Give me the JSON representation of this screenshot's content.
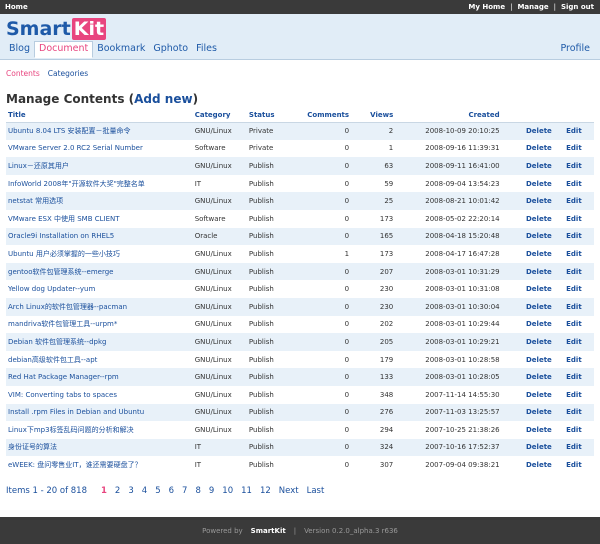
{
  "topbar": {
    "home": "Home",
    "my_home": "My Home",
    "manage": "Manage",
    "sign_out": "Sign out"
  },
  "brand": {
    "part1": "Smart",
    "part2": "Kit"
  },
  "nav": {
    "items": [
      "Blog",
      "Document",
      "Bookmark",
      "Gphoto",
      "Files"
    ],
    "active_index": 1,
    "profile": "Profile"
  },
  "subnav": {
    "contents": "Contents",
    "categories": "Categories"
  },
  "page": {
    "title": "Manage Contents (",
    "add_new": "Add new",
    "title_end": ")"
  },
  "table": {
    "headers": [
      "Title",
      "Category",
      "Status",
      "Comments",
      "Views",
      "Created",
      "",
      ""
    ],
    "delete_label": "Delete",
    "edit_label": "Edit",
    "rows": [
      {
        "title": "Ubuntu 8.04 LTS 安装配置－批量命令",
        "category": "GNU/Linux",
        "status": "Private",
        "comments": "0",
        "views": "2",
        "created": "2008-10-09 20:10:25"
      },
      {
        "title": "VMware Server 2.0 RC2 Serial Number",
        "category": "Software",
        "status": "Private",
        "comments": "0",
        "views": "1",
        "created": "2008-09-16 11:39:31"
      },
      {
        "title": "Linux－还原其用户",
        "category": "GNU/Linux",
        "status": "Publish",
        "comments": "0",
        "views": "63",
        "created": "2008-09-11 16:41:00"
      },
      {
        "title": "InfoWorld 2008年\"开源软件大奖\"完整名单",
        "category": "IT",
        "status": "Publish",
        "comments": "0",
        "views": "59",
        "created": "2008-09-04 13:54:23"
      },
      {
        "title": "netstat 常用选项",
        "category": "GNU/Linux",
        "status": "Publish",
        "comments": "0",
        "views": "25",
        "created": "2008-08-21 10:01:42"
      },
      {
        "title": "VMware ESX 中使用 SMB CLIENT",
        "category": "Software",
        "status": "Publish",
        "comments": "0",
        "views": "173",
        "created": "2008-05-02 22:20:14"
      },
      {
        "title": "Oracle9i Installation on RHEL5",
        "category": "Oracle",
        "status": "Publish",
        "comments": "0",
        "views": "165",
        "created": "2008-04-18 15:20:48"
      },
      {
        "title": "Ubuntu 用户必须掌握的一些小技巧",
        "category": "GNU/Linux",
        "status": "Publish",
        "comments": "1",
        "views": "173",
        "created": "2008-04-17 16:47:28"
      },
      {
        "title": "gentoo软件包管理系统--emerge",
        "category": "GNU/Linux",
        "status": "Publish",
        "comments": "0",
        "views": "207",
        "created": "2008-03-01 10:31:29"
      },
      {
        "title": "Yellow dog Updater--yum",
        "category": "GNU/Linux",
        "status": "Publish",
        "comments": "0",
        "views": "230",
        "created": "2008-03-01 10:31:08"
      },
      {
        "title": "Arch Linux的软件包管理器--pacman",
        "category": "GNU/Linux",
        "status": "Publish",
        "comments": "0",
        "views": "230",
        "created": "2008-03-01 10:30:04"
      },
      {
        "title": "mandriva软件包管理工具--urpm*",
        "category": "GNU/Linux",
        "status": "Publish",
        "comments": "0",
        "views": "202",
        "created": "2008-03-01 10:29:44"
      },
      {
        "title": "Debian 软件包管理系统--dpkg",
        "category": "GNU/Linux",
        "status": "Publish",
        "comments": "0",
        "views": "205",
        "created": "2008-03-01 10:29:21"
      },
      {
        "title": "debian高级软件包工具--apt",
        "category": "GNU/Linux",
        "status": "Publish",
        "comments": "0",
        "views": "179",
        "created": "2008-03-01 10:28:58"
      },
      {
        "title": "Red Hat Package Manager--rpm",
        "category": "GNU/Linux",
        "status": "Publish",
        "comments": "0",
        "views": "133",
        "created": "2008-03-01 10:28:05"
      },
      {
        "title": "VIM: Converting tabs to spaces",
        "category": "GNU/Linux",
        "status": "Publish",
        "comments": "0",
        "views": "348",
        "created": "2007-11-14 14:55:30"
      },
      {
        "title": "Install .rpm Files in Debian and Ubuntu",
        "category": "GNU/Linux",
        "status": "Publish",
        "comments": "0",
        "views": "276",
        "created": "2007-11-03 13:25:57"
      },
      {
        "title": "Linux下mp3标签乱码问题的分析和解决",
        "category": "GNU/Linux",
        "status": "Publish",
        "comments": "0",
        "views": "294",
        "created": "2007-10-25 21:38:26"
      },
      {
        "title": "身份证号的算法",
        "category": "IT",
        "status": "Publish",
        "comments": "0",
        "views": "324",
        "created": "2007-10-16 17:52:37"
      },
      {
        "title": "eWEEK: 盘问零售业IT，谁还需要硬盘了？",
        "category": "IT",
        "status": "Publish",
        "comments": "0",
        "views": "307",
        "created": "2007-09-04 09:38:21"
      }
    ]
  },
  "pager": {
    "info": "Items 1 - 20 of 818",
    "current": "1",
    "pages": [
      "2",
      "3",
      "4",
      "5",
      "6",
      "7",
      "8",
      "9",
      "10",
      "11",
      "12"
    ],
    "next": "Next",
    "last": "Last"
  },
  "footer": {
    "powered_by": "Powered by",
    "brand": "SmartKit",
    "sep": "|",
    "version": "Version 0.2.0_alpha.3 r636"
  }
}
